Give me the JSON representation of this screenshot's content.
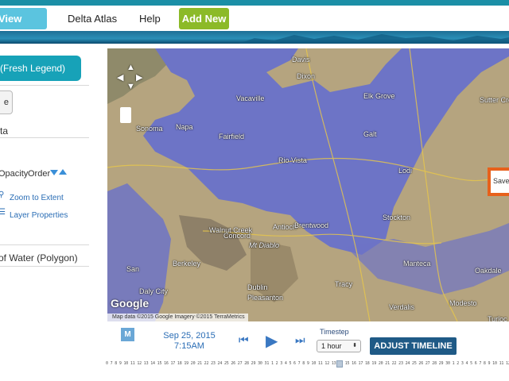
{
  "nav": {
    "view_layers": "View Layers",
    "delta_atlas": "Delta Atlas",
    "help": "Help",
    "add_new": "Add New"
  },
  "sidebar": {
    "legend_tab": "(Fresh Legend)",
    "button_label": "e",
    "section_label": "ta",
    "opacity_label": "Opacity",
    "order_label": "Order",
    "zoom_link": "Zoom to Extent",
    "properties_link": "Layer Properties",
    "layer_name": "of Water (Polygon)"
  },
  "map": {
    "labels": [
      {
        "text": "Davis"
      },
      {
        "text": "Dixon"
      },
      {
        "text": "Elk Grove"
      },
      {
        "text": "Sutter Cre"
      },
      {
        "text": "Vacaville"
      },
      {
        "text": "Galt"
      },
      {
        "text": "Sonoma"
      },
      {
        "text": "Napa"
      },
      {
        "text": "Fairfield"
      },
      {
        "text": "Rio Vista"
      },
      {
        "text": "Lodi"
      },
      {
        "text": "Antioch"
      },
      {
        "text": "Concord"
      },
      {
        "text": "Brentwood"
      },
      {
        "text": "Stockton"
      },
      {
        "text": "Walnut Creek"
      },
      {
        "text": "Mt Diablo"
      },
      {
        "text": "Berkeley"
      },
      {
        "text": "Manteca"
      },
      {
        "text": "Oakdale"
      },
      {
        "text": "Daly City"
      },
      {
        "text": "Dublin"
      },
      {
        "text": "Tracy"
      },
      {
        "text": "Pleasanton"
      },
      {
        "text": "Modesto"
      },
      {
        "text": "Verdalis"
      },
      {
        "text": "Turloc"
      },
      {
        "text": "San"
      }
    ],
    "save_popup": "Save",
    "attribution": "Map data ©2015 Google Imagery ©2015 TerraMetrics",
    "google": "Google",
    "colors": {
      "water": "#6d74c6",
      "land": "#b9a987",
      "accent": "#e7611c"
    }
  },
  "timeline": {
    "m_label": "M",
    "date": "Sep 25, 2015",
    "time": "7:15AM",
    "timestep_label": "Timestep",
    "timestep_value": "1 hour",
    "adjust_button": "ADJUST TIMELINE",
    "ticks": "0 7 8 9 10 11 12 13 14 15 16 17 18 19 20 21 22 23 24 25 26 27 28 29 30 31 1 2 3 4 5 6 7 8 9 10 11 12 13 14 15 16 17 18 19 20 21 22 23 24 25 26 27 28 29 30 1 2 3 4 5 6 7 8 9 10 11 12 13 14 15 16 17 18 19 20 21 22 23 24 25 26 27 28 29 30 31"
  }
}
